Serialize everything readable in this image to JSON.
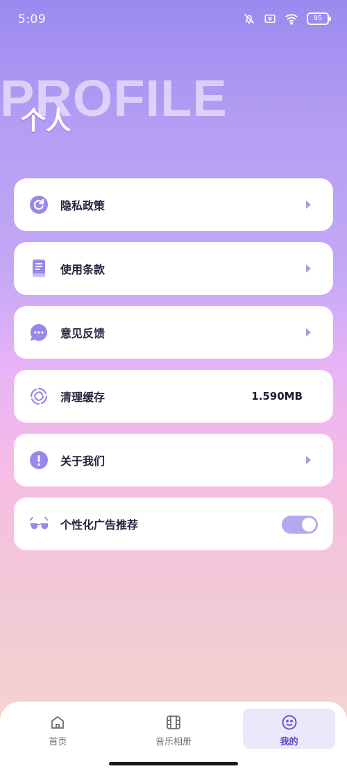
{
  "status": {
    "time": "5:09",
    "battery": "95"
  },
  "hero": {
    "bg_word": "PROFILE",
    "title": "个人"
  },
  "menu": [
    {
      "label": "隐私政策",
      "icon": "refresh-icon"
    },
    {
      "label": "使用条款",
      "icon": "document-icon"
    },
    {
      "label": "意见反馈",
      "icon": "chat-icon"
    },
    {
      "label": "清理缓存",
      "icon": "spinner-icon",
      "value": "1.590MB"
    },
    {
      "label": "关于我们",
      "icon": "info-icon"
    },
    {
      "label": "个性化广告推荐",
      "icon": "glasses-icon",
      "toggle": true
    }
  ],
  "tabs": [
    {
      "label": "首页",
      "icon": "home-icon"
    },
    {
      "label": "音乐相册",
      "icon": "film-icon"
    },
    {
      "label": "我的",
      "icon": "smile-icon",
      "active": true
    }
  ],
  "colors": {
    "accent": "#5b48c9",
    "icon": "#9a86ec"
  }
}
